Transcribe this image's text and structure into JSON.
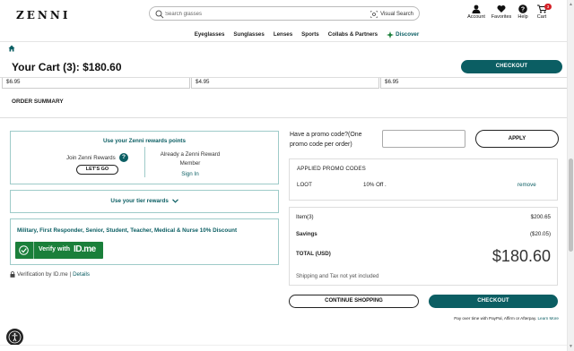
{
  "header": {
    "logo": "ZENNI",
    "search_placeholder": "Search glasses",
    "visual_search": "Visual Search",
    "account": "Account",
    "favorites": "Favorites",
    "help": "Help",
    "cart": "Cart",
    "cart_count": "3"
  },
  "nav": {
    "items": [
      "Eyeglasses",
      "Sunglasses",
      "Lenses",
      "Sports",
      "Collabs & Partners",
      "Discover"
    ]
  },
  "cart": {
    "title": "Your Cart (3): $180.60",
    "checkout_label": "CHECKOUT",
    "product_prices": [
      "$6.95",
      "$4.95",
      "$6.95"
    ]
  },
  "order_summary": {
    "tab_label": "ORDER SUMMARY"
  },
  "rewards": {
    "title": "Use your Zenni rewards points",
    "join_label": "Join Zenni Rewards",
    "help_glyph": "?",
    "lets_go": "LET'S GO",
    "already_label": "Already a Zenni Reward Member",
    "sign_in": "Sign In"
  },
  "tier": {
    "label": "Use your tier rewards"
  },
  "military": {
    "text": "Military, First Responder, Senior, Student, Teacher, Medical & Nurse 10% Discount",
    "verify_label": "Verify with",
    "idme_logo": "ID.me",
    "verification_text": "Verification by ID.me |",
    "details_link": "Details"
  },
  "promo": {
    "question": "Have a promo code?(One promo code per order)",
    "input_placeholder": "",
    "apply_label": "APPLY",
    "applied_title": "APPLIED PROMO CODES",
    "code": "LOOT",
    "discount": "10% Off .",
    "remove_label": "remove"
  },
  "totals": {
    "items_label": "Item(3)",
    "items_value": "$200.65",
    "savings_label": "Savings",
    "savings_value": "($20.05)",
    "total_label": "TOTAL (USD)",
    "total_value": "$180.60",
    "shipping_note": "Shipping and Tax not yet included"
  },
  "actions": {
    "continue_label": "CONTINUE SHOPPING",
    "checkout_label": "CHECKOUT",
    "payover_text": "Pay over time with PayPal, Affirm or Afterpay.",
    "learn_more": "Learn More"
  },
  "colors": {
    "brand_teal": "#0b5e63",
    "idme_green": "#1a7f3a",
    "badge_red": "#d42027"
  }
}
